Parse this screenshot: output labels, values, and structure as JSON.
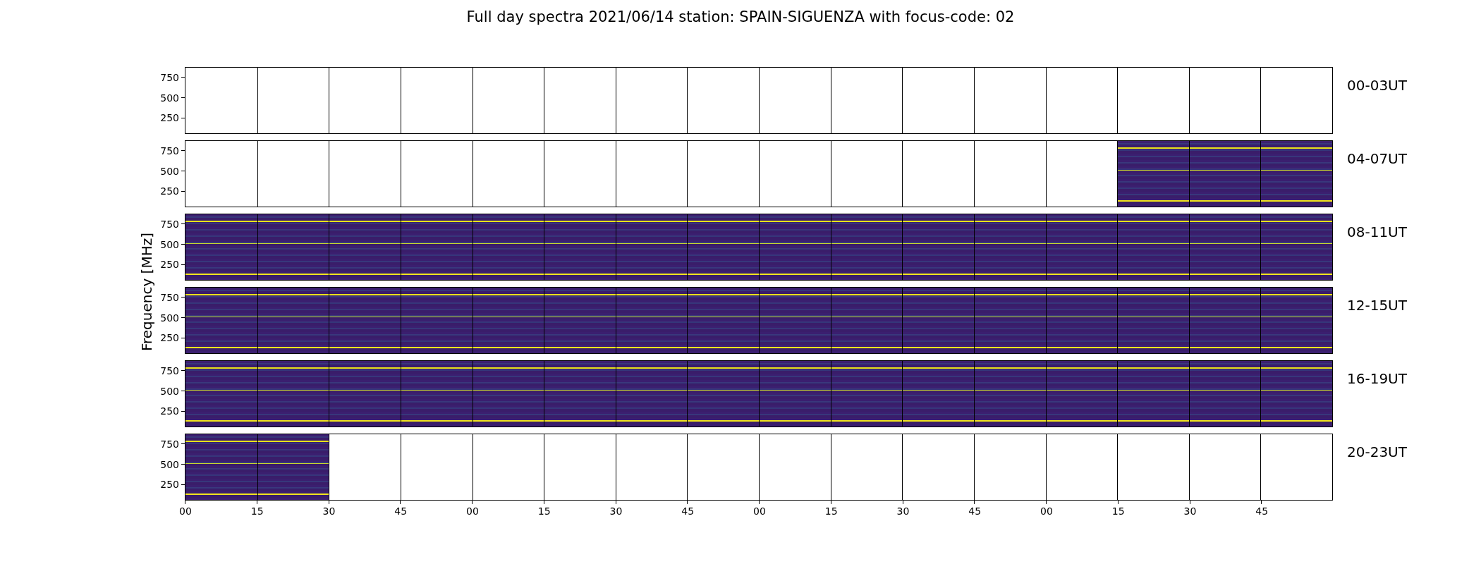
{
  "title": "Full day spectra 2021/06/14 station: SPAIN-SIGUENZA with focus-code: 02",
  "y_axis_label": "Frequency [MHz]",
  "rows": [
    {
      "label": "00-03UT",
      "y_ticks": [
        "750",
        "500",
        "250"
      ],
      "panels": [
        false,
        false,
        false,
        false,
        false,
        false,
        false,
        false,
        false,
        false,
        false,
        false,
        false,
        false,
        false,
        false
      ]
    },
    {
      "label": "04-07UT",
      "y_ticks": [
        "750",
        "500",
        "250"
      ],
      "panels": [
        false,
        false,
        false,
        false,
        false,
        false,
        false,
        false,
        false,
        false,
        false,
        false,
        false,
        true,
        true,
        true
      ]
    },
    {
      "label": "08-11UT",
      "y_ticks": [
        "750",
        "500",
        "250"
      ],
      "panels": [
        true,
        true,
        true,
        true,
        true,
        true,
        true,
        true,
        true,
        true,
        true,
        true,
        true,
        true,
        true,
        true
      ]
    },
    {
      "label": "12-15UT",
      "y_ticks": [
        "750",
        "500",
        "250"
      ],
      "panels": [
        true,
        true,
        true,
        true,
        true,
        true,
        true,
        true,
        true,
        true,
        true,
        true,
        true,
        true,
        true,
        true
      ]
    },
    {
      "label": "16-19UT",
      "y_ticks": [
        "750",
        "500",
        "250"
      ],
      "panels": [
        true,
        true,
        true,
        true,
        true,
        true,
        true,
        true,
        true,
        true,
        true,
        true,
        true,
        true,
        true,
        true
      ]
    },
    {
      "label": "20-23UT",
      "y_ticks": [
        "750",
        "500",
        "250"
      ],
      "panels": [
        true,
        true,
        false,
        false,
        false,
        false,
        false,
        false,
        false,
        false,
        false,
        false,
        false,
        false,
        false,
        false
      ]
    }
  ],
  "x_ticks": [
    "00",
    "15",
    "30",
    "45",
    "00",
    "15",
    "30",
    "45",
    "00",
    "15",
    "30",
    "45",
    "00",
    "15",
    "30",
    "45"
  ]
}
